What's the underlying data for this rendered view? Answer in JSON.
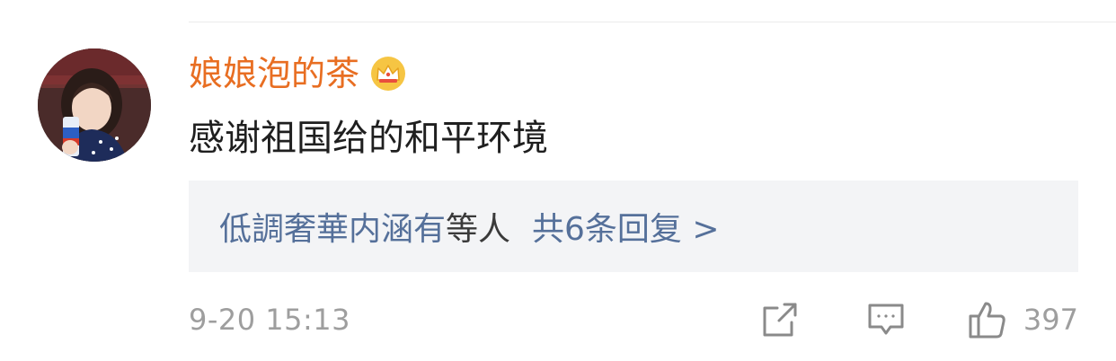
{
  "comment": {
    "username": "娘娘泡的茶",
    "user_badge_icon": "crown-icon",
    "text": "感谢祖国给的和平环境",
    "replies": {
      "participants": "低調奢華内涵有",
      "suffix": "等人",
      "summary": "共6条回复 >"
    },
    "timestamp": "9-20 15:13",
    "actions": {
      "share_icon": "share-icon",
      "comment_icon": "comment-icon",
      "like_icon": "thumbs-up-icon",
      "like_count": "397"
    }
  },
  "colors": {
    "username": "#e86e22",
    "link": "#55709a",
    "reply_bg": "#f3f4f6",
    "muted": "#9e9e9e"
  }
}
